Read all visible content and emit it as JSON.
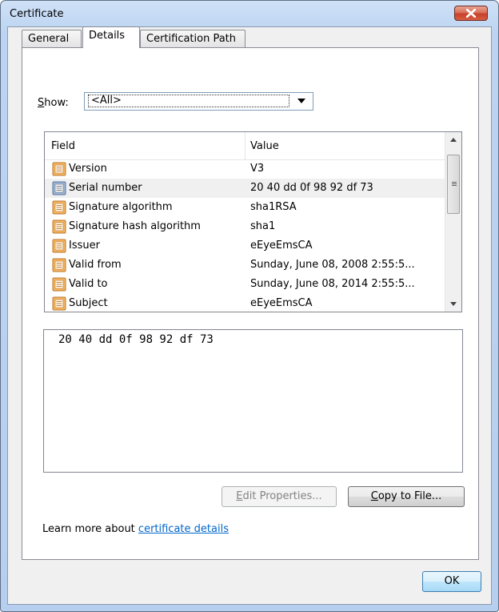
{
  "window": {
    "title": "Certificate"
  },
  "tabs": [
    {
      "label": "General",
      "active": false
    },
    {
      "label": "Details",
      "active": true
    },
    {
      "label": "Certification Path",
      "active": false
    }
  ],
  "show": {
    "label_mnemonic": "S",
    "label_rest": "how:",
    "selected_value": "<All>"
  },
  "fields_list": {
    "columns": [
      "Field",
      "Value"
    ],
    "rows": [
      {
        "field": "Version",
        "value": "V3",
        "icon": "certificate-field-icon",
        "selected": false
      },
      {
        "field": "Serial number",
        "value": "20 40 dd 0f 98 92 df 73",
        "icon": "certificate-field-icon",
        "selected": true
      },
      {
        "field": "Signature algorithm",
        "value": "sha1RSA",
        "icon": "certificate-field-icon",
        "selected": false
      },
      {
        "field": "Signature hash algorithm",
        "value": "sha1",
        "icon": "certificate-field-icon",
        "selected": false
      },
      {
        "field": "Issuer",
        "value": "eEyeEmsCA",
        "icon": "certificate-field-icon",
        "selected": false
      },
      {
        "field": "Valid from",
        "value": "Sunday, June 08, 2008 2:55:5...",
        "icon": "certificate-field-icon",
        "selected": false
      },
      {
        "field": "Valid to",
        "value": "Sunday, June 08, 2014 2:55:5...",
        "icon": "certificate-field-icon",
        "selected": false
      },
      {
        "field": "Subject",
        "value": "eEyeEmsCA",
        "icon": "certificate-field-icon",
        "selected": false
      }
    ]
  },
  "detail_text": "20 40 dd 0f 98 92 df 73",
  "buttons": {
    "edit_properties_mnemonic": "E",
    "edit_properties_rest": "dit Properties...",
    "edit_properties_enabled": false,
    "copy_to_file_mnemonic": "C",
    "copy_to_file_rest": "opy to File...",
    "ok": "OK"
  },
  "learn_more": {
    "prefix": "Learn more about ",
    "link_text": "certificate details"
  },
  "colors": {
    "link": "#0066cc",
    "close_button": "#c7402a",
    "ok_button_border": "#3c7fb1"
  }
}
